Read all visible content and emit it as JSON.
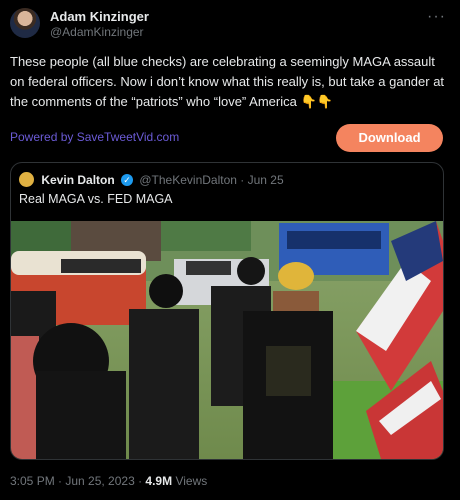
{
  "author": {
    "name": "Adam Kinzinger",
    "handle": "@AdamKinzinger"
  },
  "more_label": "···",
  "tweet_text": "These people (all blue checks) are celebrating a seemingly MAGA assault on federal officers.  Now i don’t know what this really is, but take a gander at the comments of the “patriots” who “love” America 👇👇",
  "powered_by": "Powered by SaveTweetVid.com",
  "download_label": "Download",
  "quote": {
    "name": "Kevin Dalton",
    "verified_mark": "✓",
    "handle_time": "@TheKevinDalton · Jun 25",
    "text": "Real MAGA vs. FED MAGA"
  },
  "meta": {
    "time_date": "3:05 PM · Jun 25, 2023 · ",
    "views_count": "4.9M",
    "views_label": " Views"
  },
  "colors": {
    "background": "#000000",
    "accent_link": "#6b5bd6",
    "download_button": "#f4845f",
    "verified": "#1d9bf0"
  },
  "icons": [
    "avatar",
    "more-dots-icon",
    "verified-badge-icon",
    "point-down-emoji"
  ]
}
